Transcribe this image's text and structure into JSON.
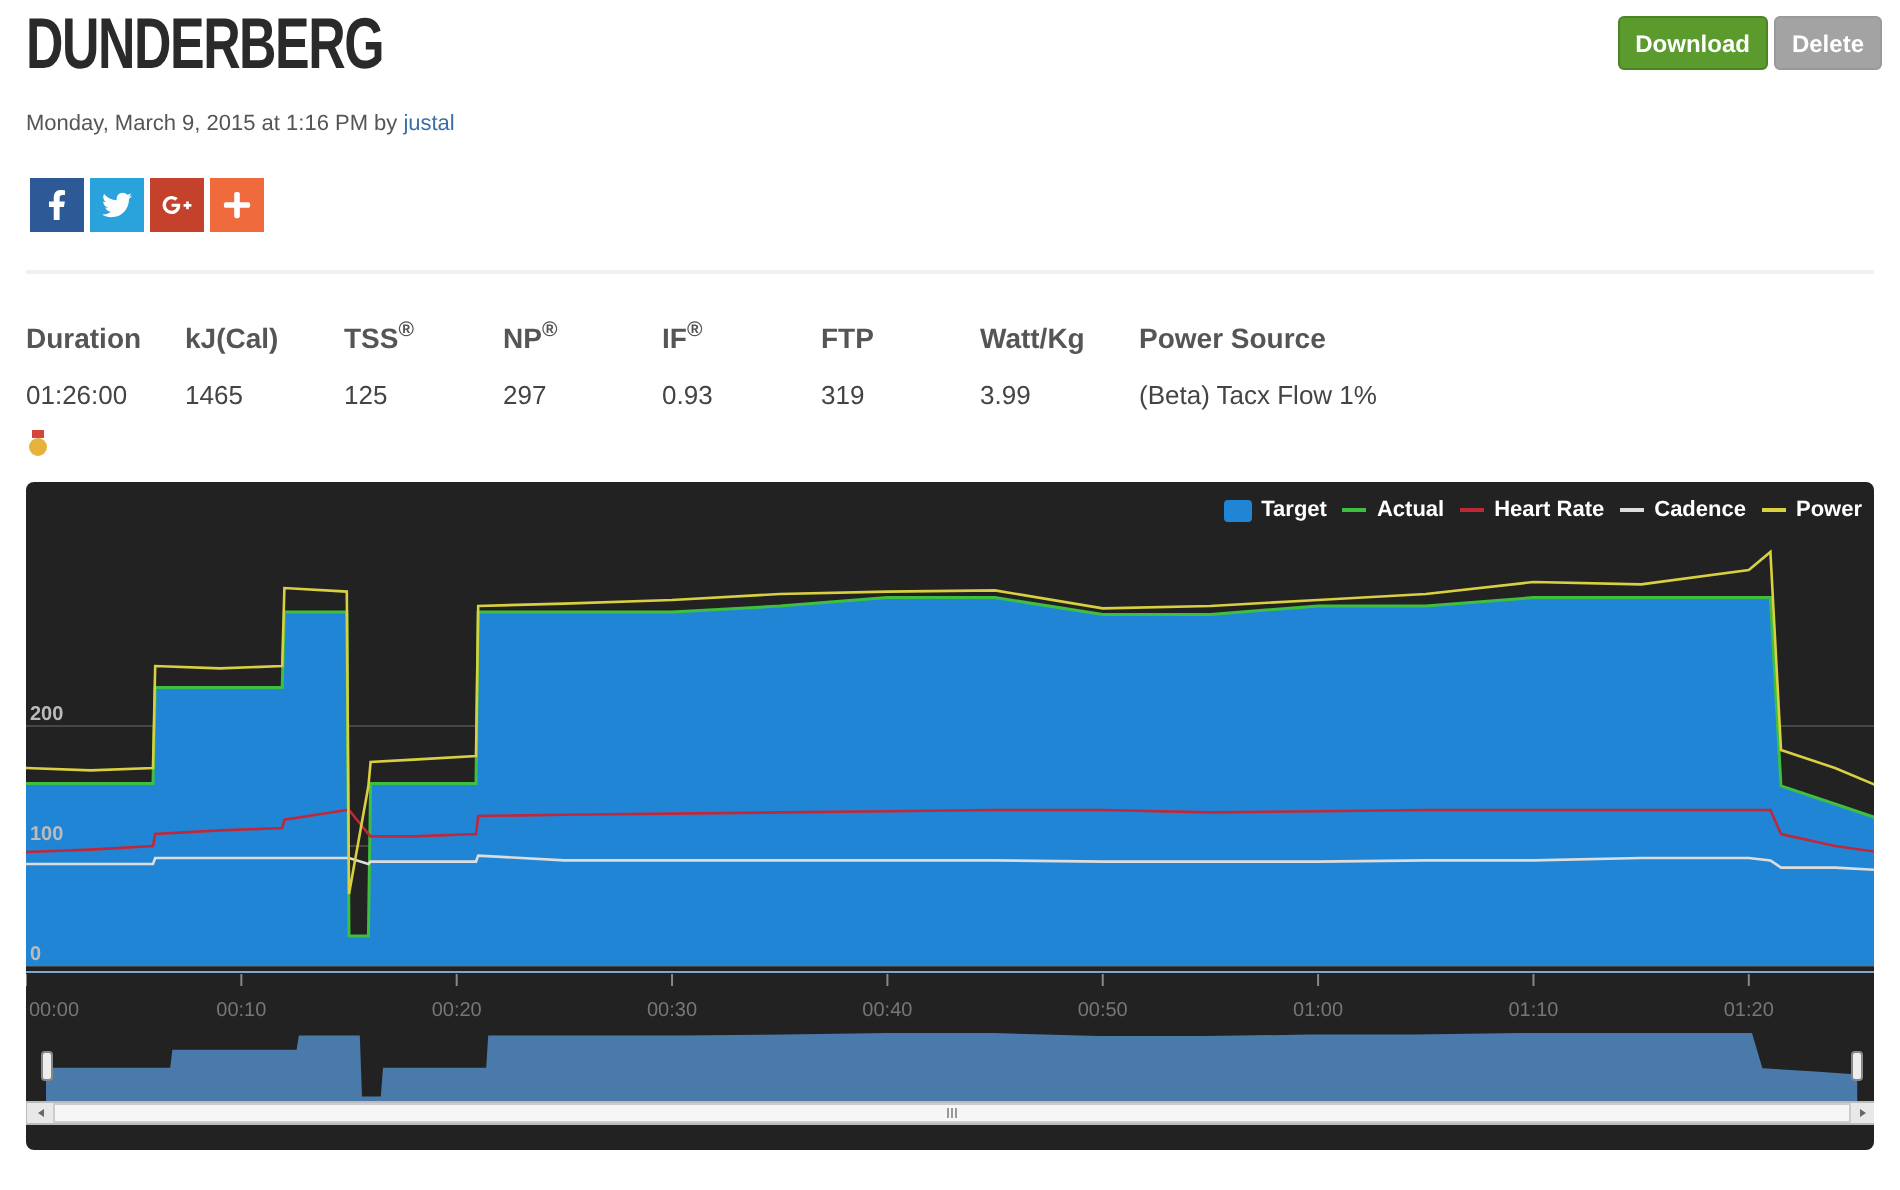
{
  "title": "DUNDERBERG",
  "actions": [
    {
      "label": "Download",
      "kind": "primary"
    },
    {
      "label": "Delete",
      "kind": "secondary"
    }
  ],
  "meta": {
    "text": "Monday, March 9, 2015 at 1:16 PM by",
    "author": "justal"
  },
  "share": [
    {
      "kind": "facebook"
    },
    {
      "kind": "twitter"
    },
    {
      "kind": "googleplus"
    },
    {
      "kind": "more"
    }
  ],
  "stats": [
    {
      "label": "Duration",
      "value": "01:26:00"
    },
    {
      "label": "kJ(Cal)",
      "value": "1465"
    },
    {
      "label": "TSS$^{®}$",
      "value": "125"
    },
    {
      "label": "NP$^{®}$",
      "value": "297"
    },
    {
      "label": "IF$^{®}$",
      "value": "0.93"
    },
    {
      "label": "FTP",
      "value": "319"
    },
    {
      "label": "Watt/Kg",
      "value": "3.99"
    },
    {
      "label": "Power Source",
      "value": "(Beta) Tacx Flow 1%"
    }
  ],
  "chart": {
    "chart_data": {
      "type": "line",
      "x": [
        0,
        3,
        5.9,
        6,
        9,
        11.9,
        12,
        14.9,
        15,
        15.9,
        16,
        18,
        20.9,
        21,
        25,
        30,
        35,
        40,
        45,
        50,
        55,
        60,
        65,
        70,
        75,
        80,
        81,
        81.5,
        84,
        86
      ],
      "series": [
        {
          "name": "Target",
          "type": "area",
          "color": "#2185d5",
          "values": [
            152,
            152,
            152,
            232,
            232,
            232,
            295,
            295,
            25,
            25,
            152,
            152,
            152,
            295,
            295,
            295,
            300,
            307,
            307,
            293,
            293,
            300,
            300,
            307,
            307,
            307,
            307,
            150,
            135,
            123
          ]
        },
        {
          "name": "Actual",
          "type": "line",
          "color": "#3fbf3f",
          "values": [
            152,
            152,
            152,
            232,
            232,
            232,
            295,
            295,
            25,
            25,
            152,
            152,
            152,
            295,
            295,
            295,
            300,
            307,
            307,
            293,
            293,
            300,
            300,
            307,
            307,
            307,
            307,
            150,
            135,
            123
          ]
        },
        {
          "name": "Heart Rate",
          "type": "line",
          "color": "#c0283a",
          "values": [
            95,
            97,
            100,
            110,
            113,
            115,
            122,
            130,
            130,
            110,
            108,
            108,
            110,
            125,
            126,
            127,
            128,
            129,
            130,
            130,
            128,
            129,
            130,
            130,
            130,
            130,
            130,
            110,
            100,
            95
          ]
        },
        {
          "name": "Cadence",
          "type": "line",
          "color": "#dddddd",
          "values": [
            85,
            85,
            85,
            90,
            90,
            90,
            90,
            90,
            90,
            85,
            87,
            87,
            87,
            92,
            88,
            88,
            88,
            88,
            88,
            87,
            87,
            87,
            88,
            88,
            90,
            90,
            88,
            82,
            82,
            80
          ]
        },
        {
          "name": "Power",
          "type": "line",
          "color": "#d8d040",
          "values": [
            165,
            163,
            165,
            250,
            248,
            250,
            315,
            312,
            60,
            150,
            170,
            172,
            175,
            300,
            302,
            305,
            310,
            312,
            313,
            298,
            300,
            305,
            310,
            320,
            318,
            330,
            345,
            180,
            165,
            150
          ]
        }
      ],
      "legend": "top-right",
      "xlim": [
        0,
        86
      ],
      "ylim": [
        0,
        400
      ],
      "yticks": [
        0,
        100,
        200
      ],
      "xticks": [
        {
          "value": 0,
          "label": "00:00"
        },
        {
          "value": 10,
          "label": "00:10"
        },
        {
          "value": 20,
          "label": "00:20"
        },
        {
          "value": 30,
          "label": "00:30"
        },
        {
          "value": 40,
          "label": "00:40"
        },
        {
          "value": 50,
          "label": "00:50"
        },
        {
          "value": 60,
          "label": "01:00"
        },
        {
          "value": 70,
          "label": "01:10"
        },
        {
          "value": 80,
          "label": "01:20"
        }
      ]
    }
  }
}
